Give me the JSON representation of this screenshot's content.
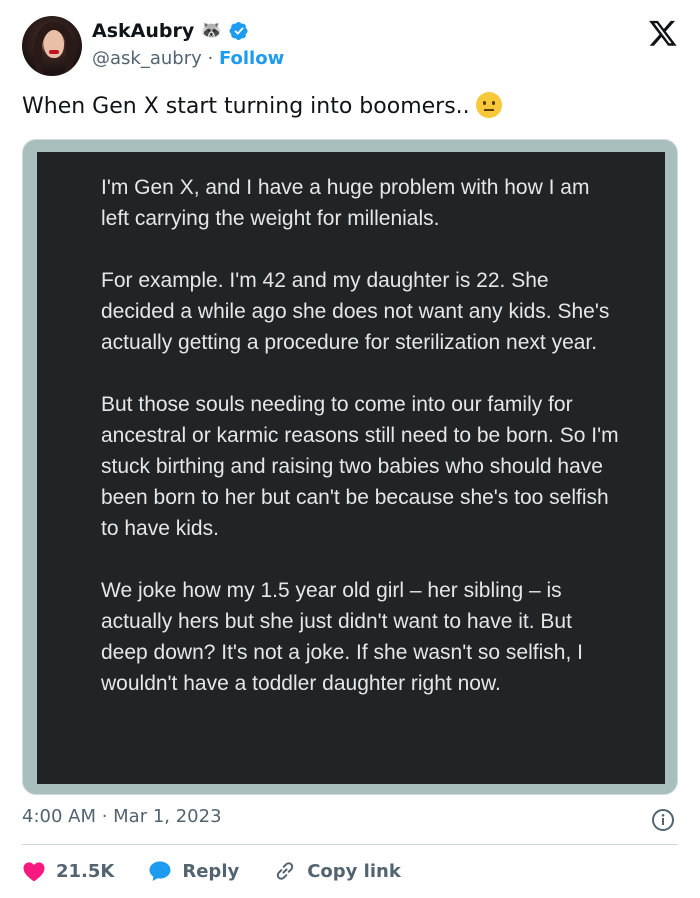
{
  "author": {
    "display_name": "AskAubry",
    "name_emoji": "🦝",
    "handle": "@ask_aubry",
    "separator": "·",
    "follow_label": "Follow"
  },
  "tweet": {
    "text": "When Gen X start turning into boomers.."
  },
  "media": {
    "paragraphs": [
      "I'm Gen X, and I have a huge problem with how I am left carrying the weight for millenials.",
      "For example. I'm 42 and my daughter is 22. She decided a while ago she does not want any kids. She's actually getting a procedure for sterilization next year.",
      "But those souls needing to come into our family for ancestral or karmic reasons still need to be born. So I'm stuck birthing and raising two babies who should have been born to her but can't be because she's too selfish to have kids.",
      "We joke how my 1.5 year old girl – her sibling – is actually hers but she just didn't want to have it. But deep down? It's not a joke. If she wasn't so selfish, I wouldn't have a toddler daughter right now."
    ]
  },
  "meta": {
    "timestamp": "4:00 AM · Mar 1, 2023"
  },
  "actions": {
    "likes": "21.5K",
    "reply_label": "Reply",
    "copy_link_label": "Copy link"
  },
  "colors": {
    "accent": "#1d9bf0",
    "like": "#f91880",
    "text": "#0f1419",
    "muted": "#536471"
  },
  "icons": [
    "x-logo-icon",
    "verified-badge-icon",
    "raccoon-emoji-icon",
    "confused-face-emoji-icon",
    "info-icon",
    "heart-icon",
    "reply-bubble-icon",
    "link-icon"
  ]
}
